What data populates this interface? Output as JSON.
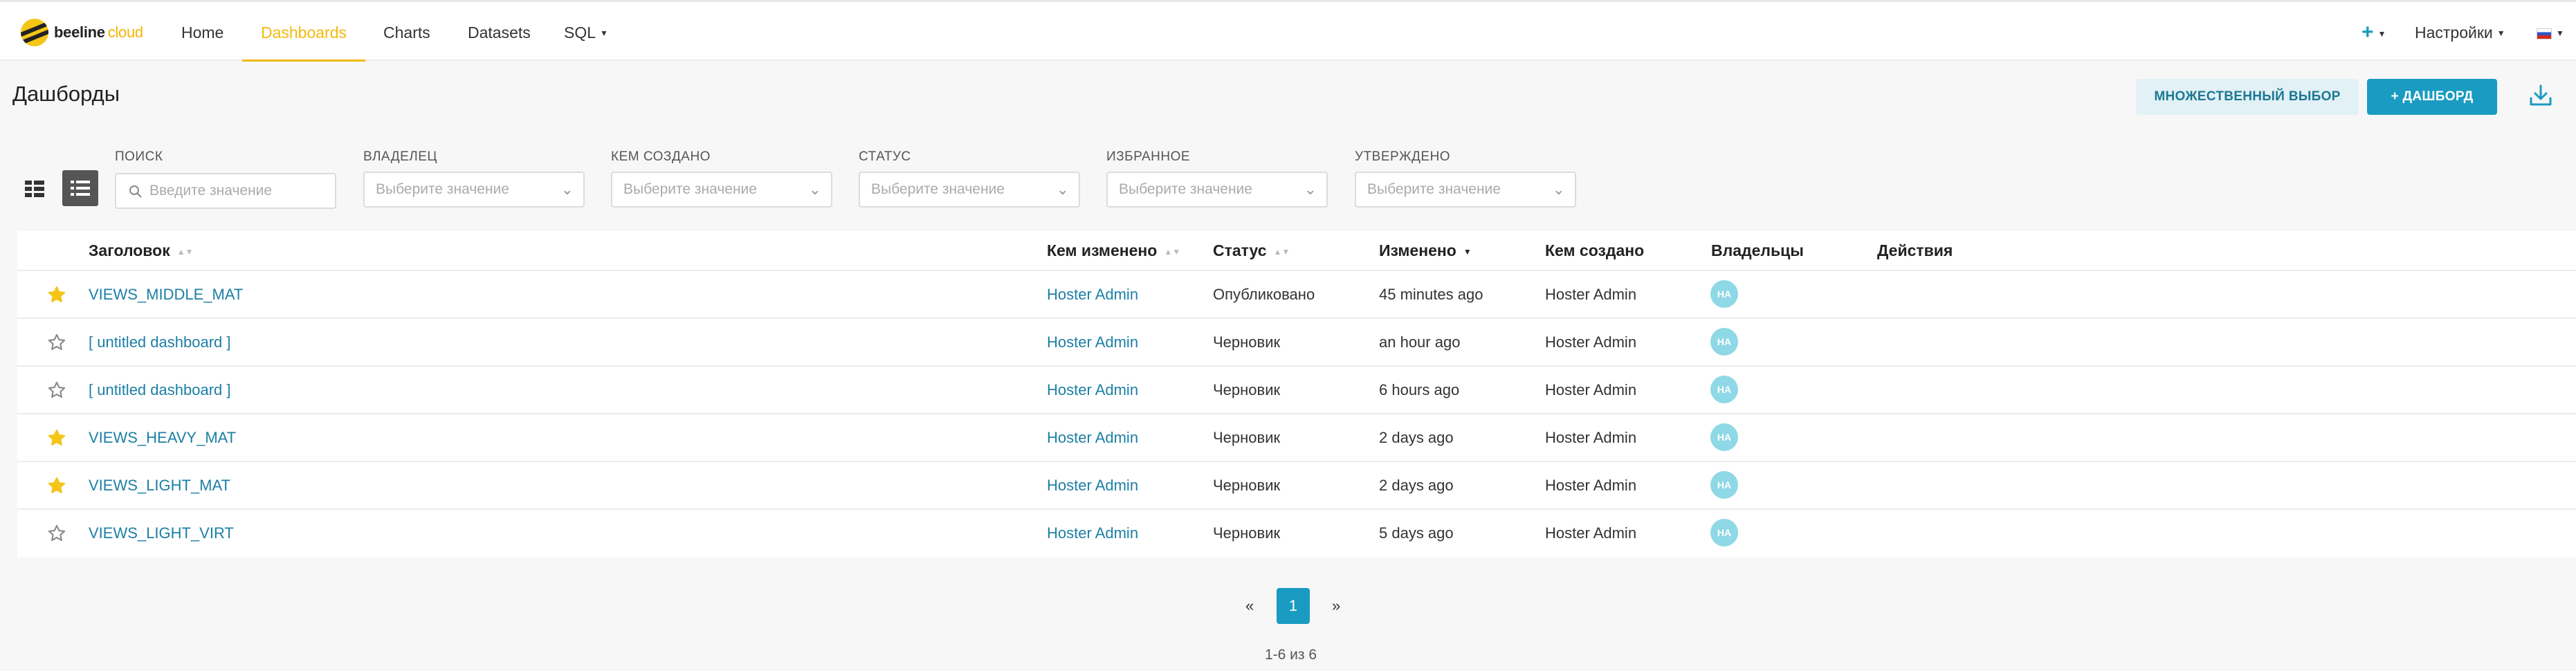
{
  "brand": {
    "name": "beeline",
    "suffix": "cloud"
  },
  "nav": {
    "items": [
      {
        "label": "Home",
        "active": false
      },
      {
        "label": "Dashboards",
        "active": true
      },
      {
        "label": "Charts",
        "active": false
      },
      {
        "label": "Datasets",
        "active": false
      },
      {
        "label": "SQL",
        "active": false
      }
    ],
    "settings_label": "Настройки",
    "language_flag": "ru-flag-icon"
  },
  "page": {
    "title": "Дашборды",
    "multi_select_label": "МНОЖЕСТВЕННЫЙ ВЫБОР",
    "add_dashboard_label": "ДАШБОРД"
  },
  "filters": {
    "search": {
      "label": "ПОИСК",
      "placeholder": "Введите значение"
    },
    "owner": {
      "label": "ВЛАДЕЛЕЦ",
      "placeholder": "Выберите значение"
    },
    "created_by": {
      "label": "КЕМ СОЗДАНО",
      "placeholder": "Выберите значение"
    },
    "status": {
      "label": "СТАТУС",
      "placeholder": "Выберите значение"
    },
    "favorite": {
      "label": "ИЗБРАННОЕ",
      "placeholder": "Выберите значение"
    },
    "certified": {
      "label": "УТВЕРЖДЕНО",
      "placeholder": "Выберите значение"
    }
  },
  "table": {
    "columns": {
      "title": "Заголовок",
      "modified_by": "Кем изменено",
      "status": "Статус",
      "modified": "Изменено",
      "created_by": "Кем создано",
      "owners": "Владельцы",
      "actions": "Действия"
    },
    "rows": [
      {
        "favorite": true,
        "title": "VIEWS_MIDDLE_MAT",
        "modified_by": "Hoster Admin",
        "status": "Опубликовано",
        "modified": "45 minutes ago",
        "created_by": "Hoster Admin",
        "owner_initials": "HA"
      },
      {
        "favorite": false,
        "title": "[ untitled dashboard ]",
        "modified_by": "Hoster Admin",
        "status": "Черновик",
        "modified": "an hour ago",
        "created_by": "Hoster Admin",
        "owner_initials": "HA"
      },
      {
        "favorite": false,
        "title": "[ untitled dashboard ]",
        "modified_by": "Hoster Admin",
        "status": "Черновик",
        "modified": "6 hours ago",
        "created_by": "Hoster Admin",
        "owner_initials": "HA"
      },
      {
        "favorite": true,
        "title": "VIEWS_HEAVY_MAT",
        "modified_by": "Hoster Admin",
        "status": "Черновик",
        "modified": "2 days ago",
        "created_by": "Hoster Admin",
        "owner_initials": "HA"
      },
      {
        "favorite": true,
        "title": "VIEWS_LIGHT_MAT",
        "modified_by": "Hoster Admin",
        "status": "Черновик",
        "modified": "2 days ago",
        "created_by": "Hoster Admin",
        "owner_initials": "HA"
      },
      {
        "favorite": false,
        "title": "VIEWS_LIGHT_VIRT",
        "modified_by": "Hoster Admin",
        "status": "Черновик",
        "modified": "5 days ago",
        "created_by": "Hoster Admin",
        "owner_initials": "HA"
      }
    ]
  },
  "pagination": {
    "prev": "«",
    "current": "1",
    "next": "»",
    "summary": "1-6 из 6"
  },
  "colors": {
    "accent": "#1a9bc2",
    "brand_yellow": "#f2b90c",
    "link": "#1c7fa5",
    "avatar": "#8fd8e6",
    "star_filled": "#f5c518"
  }
}
